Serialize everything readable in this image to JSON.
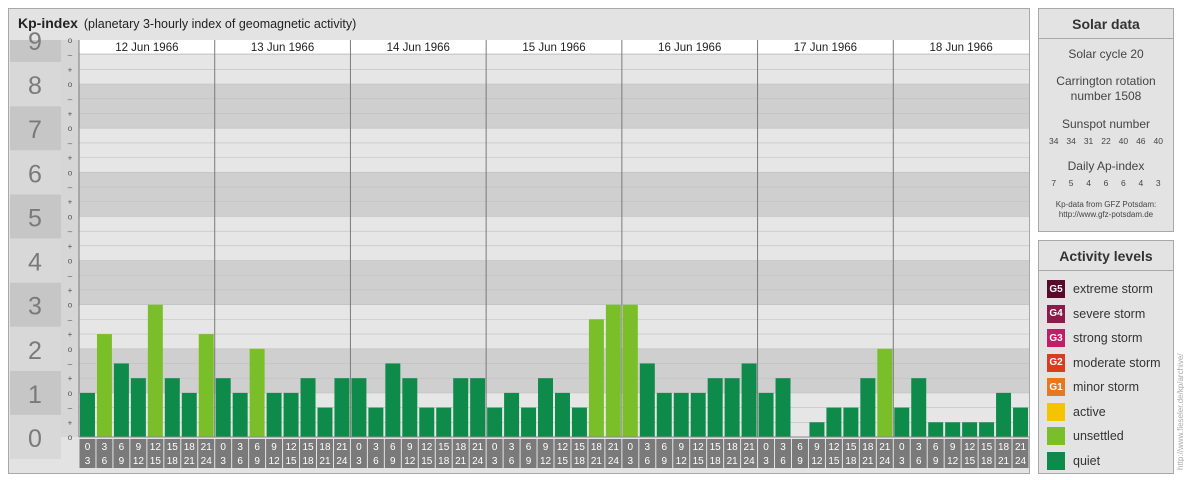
{
  "header": {
    "title": "Kp-index",
    "subtitle": "(planetary 3-hourly index of geomagnetic activity)"
  },
  "chart_data": {
    "type": "bar",
    "ylim": [
      0,
      9
    ],
    "y_ticks": [
      "0",
      "1",
      "2",
      "3",
      "4",
      "5",
      "6",
      "7",
      "8",
      "9"
    ],
    "minor_ticks": [
      "o",
      "+",
      "–"
    ],
    "days": [
      "12 Jun 1966",
      "13 Jun 1966",
      "14 Jun 1966",
      "15 Jun 1966",
      "16 Jun 1966",
      "17 Jun 1966",
      "18 Jun 1966"
    ],
    "interval_labels": [
      [
        "0",
        "3"
      ],
      [
        "3",
        "6"
      ],
      [
        "6",
        "9"
      ],
      [
        "9",
        "12"
      ],
      [
        "12",
        "15"
      ],
      [
        "15",
        "18"
      ],
      [
        "18",
        "21"
      ],
      [
        "21",
        "24"
      ]
    ],
    "values": [
      1.0,
      2.333,
      1.667,
      1.333,
      3.0,
      1.333,
      1.0,
      2.333,
      1.333,
      1.0,
      2.0,
      1.0,
      1.0,
      1.333,
      0.667,
      1.333,
      1.333,
      0.667,
      1.667,
      1.333,
      0.667,
      0.667,
      1.333,
      1.333,
      0.667,
      1.0,
      0.667,
      1.333,
      1.0,
      0.667,
      2.667,
      3.0,
      3.0,
      1.667,
      1.0,
      1.0,
      1.0,
      1.333,
      1.333,
      1.667,
      1.0,
      1.333,
      0.0,
      0.333,
      0.667,
      0.667,
      1.333,
      2.0,
      0.667,
      1.333,
      0.333,
      0.333,
      0.333,
      0.333,
      1.0,
      0.667
    ],
    "colors": {
      "quiet": "#0e8a4a",
      "unsettled": "#7abf2a"
    }
  },
  "solar": {
    "title": "Solar data",
    "cycle": "Solar cycle 20",
    "rotation_line1": "Carrington rotation",
    "rotation_line2": "number 1508",
    "sunspot_title": "Sunspot number",
    "sunspot_values": [
      "34",
      "34",
      "31",
      "22",
      "40",
      "46",
      "40"
    ],
    "ap_title": "Daily Ap-index",
    "ap_values": [
      "7",
      "5",
      "4",
      "6",
      "6",
      "4",
      "3"
    ],
    "source_line1": "Kp-data from GFZ Potsdam:",
    "source_line2": "http://www.gfz-potsdam.de"
  },
  "activity": {
    "title": "Activity levels",
    "levels": [
      {
        "code": "G5",
        "label": "extreme storm",
        "color": "#5a0b2a"
      },
      {
        "code": "G4",
        "label": "severe storm",
        "color": "#8c1a4a"
      },
      {
        "code": "G3",
        "label": "strong storm",
        "color": "#c21e66"
      },
      {
        "code": "G2",
        "label": "moderate storm",
        "color": "#dc3b1f"
      },
      {
        "code": "G1",
        "label": "minor storm",
        "color": "#e7781f"
      },
      {
        "code": "",
        "label": "active",
        "color": "#f5c400"
      },
      {
        "code": "",
        "label": "unsettled",
        "color": "#7abf2a"
      },
      {
        "code": "",
        "label": "quiet",
        "color": "#0e8a4a"
      }
    ]
  },
  "credit": "http://www.fieseler.de/kp/archive/"
}
